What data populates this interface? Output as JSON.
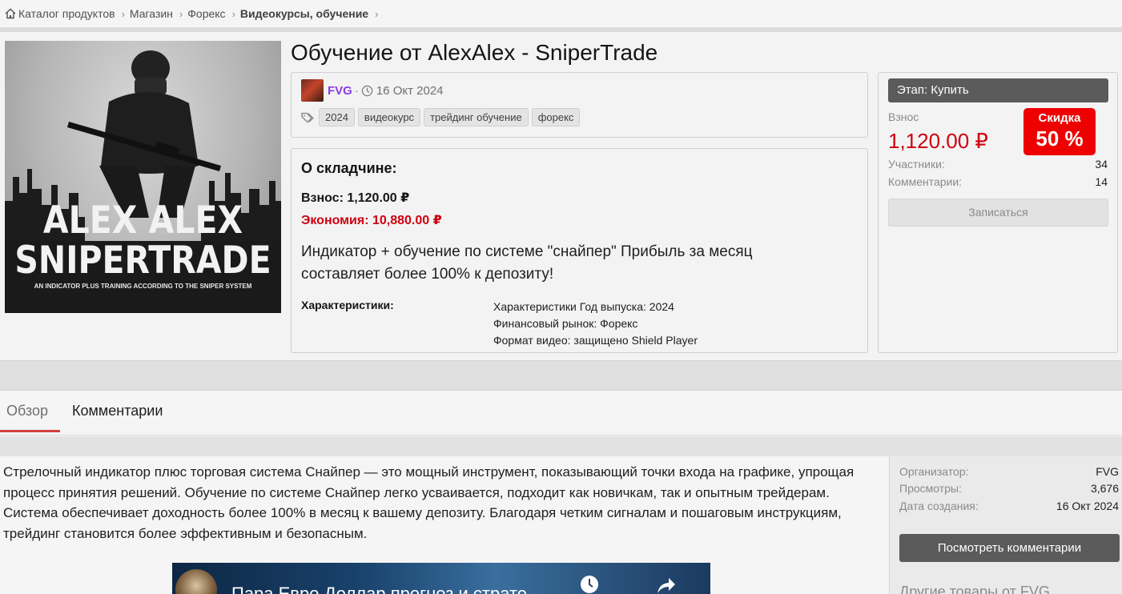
{
  "breadcrumb": {
    "items": [
      "Каталог продуктов",
      "Магазин",
      "Форекс",
      "Видеокурсы, обучение"
    ]
  },
  "cover": {
    "line1": "ALEX ALEX",
    "line2": "SNIPERTRADE",
    "subtitle": "AN INDICATOR PLUS TRAINING ACCORDING TO THE SNIPER SYSTEM"
  },
  "product": {
    "title": "Обучение от AlexAlex - SniperTrade",
    "author": "FVG",
    "separator": "·",
    "date": "16 Окт 2024",
    "tags": [
      "2024",
      "видеокурс",
      "трейдинг обучение",
      "форекс"
    ]
  },
  "about": {
    "heading": "О складчине:",
    "contribution": "Взнос: 1,120.00 ₽",
    "economy": "Экономия: 10,880.00 ₽",
    "description": "Индикатор + обучение по системе \"снайпер\" Прибыль за месяц составляет более 100% к депозиту!",
    "characteristics_label": "Характеристики:",
    "characteristics": [
      "Характеристики Год выпуска: 2024",
      "Финансовый рынок: Форекс",
      "Формат видео: защищено Shield Player"
    ]
  },
  "purchase": {
    "stage": "Этап: Купить",
    "price_label": "Взнос",
    "price": "1,120.00 ₽",
    "discount_label": "Скидка",
    "discount_value": "50 %",
    "participants_label": "Участники:",
    "participants": "34",
    "comments_label": "Комментарии:",
    "comments": "14",
    "join_label": "Записаться"
  },
  "tabs": [
    "Обзор",
    "Комментарии"
  ],
  "overview": {
    "text": "Стрелочный индикатор плюс торговая система Снайпер — это мощный инструмент, показывающий точки входа на графике, упрощая процесс принятия решений. Обучение по системе Снайпер легко усваивается, подходит как новичкам, так и опытным трейдерам. Система обеспечивает доходность более 100% в месяц к вашему депозиту. Благодаря четким сигналам и пошаговым инструкциям, трейдинг становится более эффективным и безопасным.",
    "video_title": "Пара Евро Доллар прогноз и страте..."
  },
  "sidebar": {
    "organizer_label": "Организатор:",
    "organizer": "FVG",
    "views_label": "Просмотры:",
    "views": "3,676",
    "created_label": "Дата создания:",
    "created": "16 Окт 2024",
    "view_comments": "Посмотреть комментарии",
    "other_heading": "Другие товары от FVG"
  },
  "colors": {
    "accent_red": "#d0000f",
    "discount_bg": "#ee0000",
    "author_purple": "#8a3ce0",
    "dark_button": "#5b5b5b",
    "tab_underline": "#d44040"
  },
  "icons": [
    "home-icon",
    "clock-icon",
    "tag-icon",
    "watch-later-icon",
    "share-icon"
  ]
}
